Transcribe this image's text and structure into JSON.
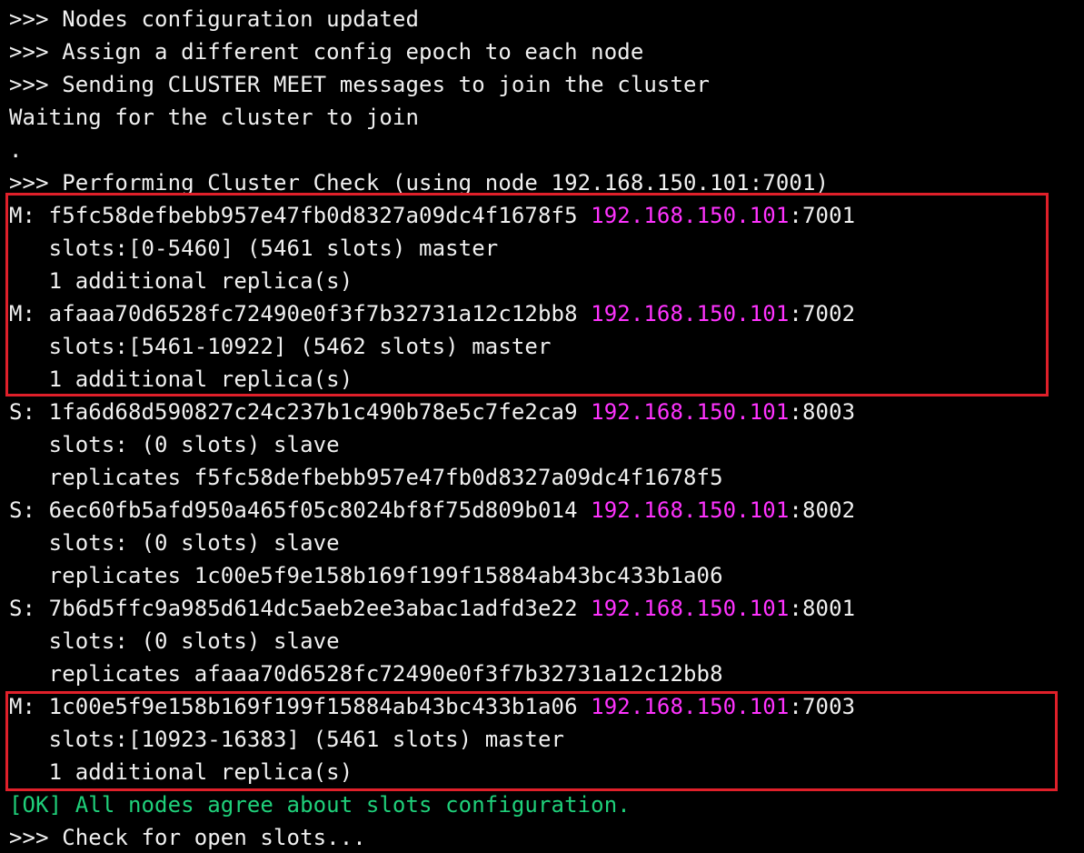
{
  "colors": {
    "background": "#000000",
    "text": "#f0f0f0",
    "ip_highlight": "#ff33ff",
    "ok_text": "#1fd07a",
    "annotation_box": "#e0202a"
  },
  "terminal": {
    "lines": [
      {
        "text": ">>> Nodes configuration updated"
      },
      {
        "text": ">>> Assign a different config epoch to each node"
      },
      {
        "text": ">>> Sending CLUSTER MEET messages to join the cluster"
      },
      {
        "text": "Waiting for the cluster to join"
      },
      {
        "text": "."
      },
      {
        "text": ">>> Performing Cluster Check (using node 192.168.150.101:7001)"
      },
      {
        "pre": "M: f5fc58defbebb957e47fb0d8327a09dc4f1678f5 ",
        "ip": "192.168.150.101",
        "post": ":7001"
      },
      {
        "text": "   slots:[0-5460] (5461 slots) master"
      },
      {
        "text": "   1 additional replica(s)"
      },
      {
        "pre": "M: afaaa70d6528fc72490e0f3f7b32731a12c12bb8 ",
        "ip": "192.168.150.101",
        "post": ":7002"
      },
      {
        "text": "   slots:[5461-10922] (5462 slots) master"
      },
      {
        "text": "   1 additional replica(s)"
      },
      {
        "pre": "S: 1fa6d68d590827c24c237b1c490b78e5c7fe2ca9 ",
        "ip": "192.168.150.101",
        "post": ":8003"
      },
      {
        "text": "   slots: (0 slots) slave"
      },
      {
        "text": "   replicates f5fc58defbebb957e47fb0d8327a09dc4f1678f5"
      },
      {
        "pre": "S: 6ec60fb5afd950a465f05c8024bf8f75d809b014 ",
        "ip": "192.168.150.101",
        "post": ":8002"
      },
      {
        "text": "   slots: (0 slots) slave"
      },
      {
        "text": "   replicates 1c00e5f9e158b169f199f15884ab43bc433b1a06"
      },
      {
        "pre": "S: 7b6d5ffc9a985d614dc5aeb2ee3abac1adfd3e22 ",
        "ip": "192.168.150.101",
        "post": ":8001"
      },
      {
        "text": "   slots: (0 slots) slave"
      },
      {
        "text": "   replicates afaaa70d6528fc72490e0f3f7b32731a12c12bb8"
      },
      {
        "pre": "M: 1c00e5f9e158b169f199f15884ab43bc433b1a06 ",
        "ip": "192.168.150.101",
        "post": ":7003"
      },
      {
        "text": "   slots:[10923-16383] (5461 slots) master"
      },
      {
        "text": "   1 additional replica(s)"
      },
      {
        "text": "[OK] All nodes agree about slots configuration."
      },
      {
        "text": ">>> Check for open slots..."
      }
    ]
  }
}
